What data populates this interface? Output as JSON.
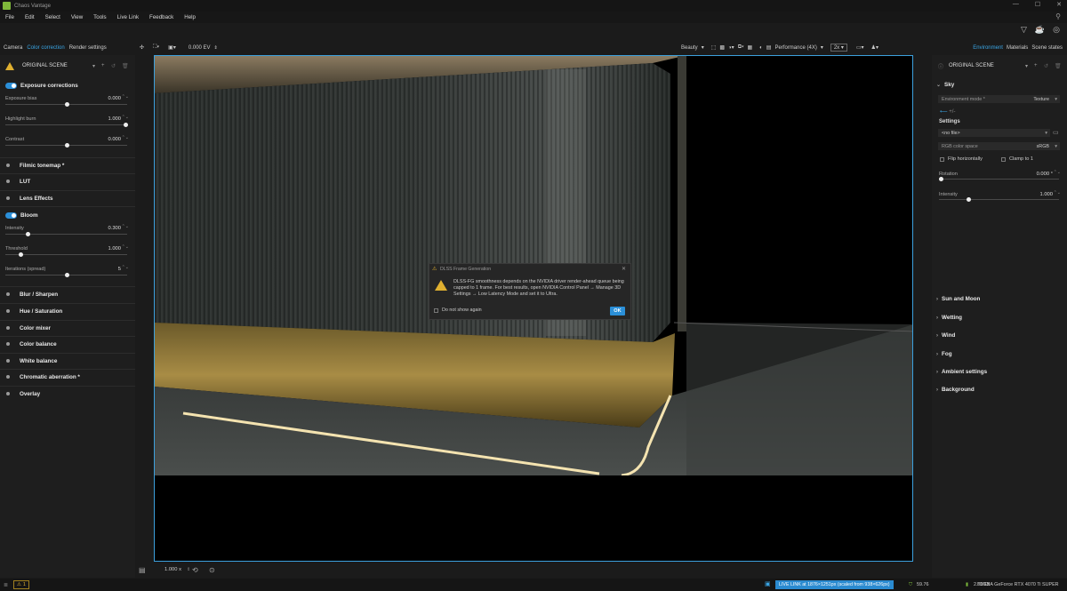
{
  "window": {
    "title": "Chaos Vantage",
    "app_icon": "chaos-vantage-logo"
  },
  "menu": [
    "File",
    "Edit",
    "Select",
    "View",
    "Tools",
    "Live Link",
    "Feedback",
    "Help"
  ],
  "left_tabs": [
    "Camera",
    "Color correction",
    "Render settings"
  ],
  "left_tab_active": "Color correction",
  "right_tabs": [
    "Environment",
    "Materials",
    "Scene states"
  ],
  "right_tab_active": "Environment",
  "toolbar": {
    "ev": "0.000 EV",
    "render_element": "Beauty",
    "quality": "Performance (4X)",
    "scale": "2x"
  },
  "left": {
    "scene": "ORIGINAL SCENE",
    "exposure": {
      "label": "Exposure corrections",
      "params": [
        {
          "label": "Exposure bias",
          "value": "0.000",
          "pos": 0.5
        },
        {
          "label": "Highlight burn",
          "value": "1.000",
          "pos": 1.0
        },
        {
          "label": "Contrast",
          "value": "0.000",
          "pos": 0.5
        }
      ]
    },
    "sections_a": [
      "Filmic tonemap *",
      "LUT",
      "Lens Effects"
    ],
    "bloom": {
      "label": "Bloom",
      "params": [
        {
          "label": "Intensity",
          "value": "0.300",
          "pos": 0.17
        },
        {
          "label": "Threshold",
          "value": "1.000",
          "pos": 0.11
        },
        {
          "label": "Iterations (spread)",
          "value": "5",
          "pos": 0.5
        }
      ]
    },
    "sections_b": [
      "Blur / Sharpen",
      "Hue / Saturation",
      "Color mixer",
      "Color balance",
      "White balance",
      "Chromatic aberration *",
      "Overlay"
    ]
  },
  "right": {
    "scene": "ORIGINAL SCENE",
    "sky": "Sky",
    "env_mode_label": "Environment mode *",
    "env_mode_value": "Texture",
    "settings": "Settings",
    "file": "<no file>",
    "colorspace_label": "RGB color space",
    "colorspace_value": "sRGB",
    "flip": "Flip horizontally",
    "clamp": "Clamp to 1",
    "rotation": {
      "label": "Rotation",
      "value": "0.000 °",
      "pos": 0.0
    },
    "intensity": {
      "label": "Intensity",
      "value": "1.000",
      "pos": 0.24
    },
    "sections": [
      "Sun and Moon",
      "Wetting",
      "Wind",
      "Fog",
      "Ambient settings",
      "Background"
    ]
  },
  "dialog": {
    "title": "DLSS Frame Generation",
    "message": "DLSS-FG smoothness depends on the NVIDIA driver render-ahead queue being capped to 1 frame. For best results, open NVIDIA Control Panel → Manage 3D Settings → Low Latency Mode and set it to Ultra.",
    "checkbox": "Do not show again",
    "ok": "OK"
  },
  "bottom": {
    "zoom": "1.000 x"
  },
  "status": {
    "warnings": "1",
    "live_link": "LIVE LINK at 1876×1251px (scaled from 938×626px)",
    "fps": "59.76",
    "memory": "2.72GB",
    "gpu": "NVIDIA GeForce RTX 4070 Ti SUPER"
  },
  "colors": {
    "accent": "#2b8fd8",
    "warning": "#e0b030",
    "viewport_border": "#3ca0dd"
  }
}
